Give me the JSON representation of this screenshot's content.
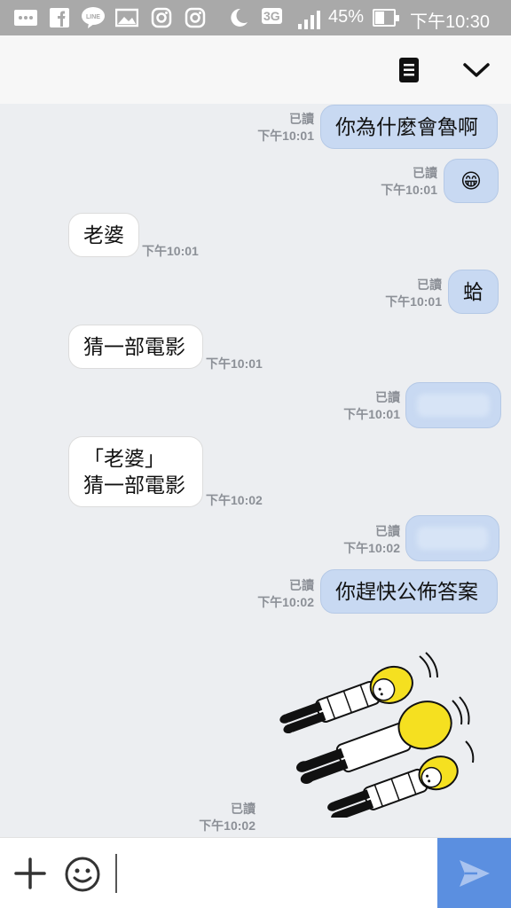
{
  "status_bar": {
    "icons": [
      "chat-dots-icon",
      "facebook-icon",
      "line-icon",
      "gallery-icon",
      "instagram-icon",
      "instagram-icon",
      "moon-icon",
      "signal-icon",
      "battery-icon"
    ],
    "network": "3G",
    "battery": "45%",
    "time": "下午10:30"
  },
  "header": {
    "menu_icon": "notes-icon",
    "collapse_icon": "chevron-down-icon"
  },
  "messages": [
    {
      "side": "me",
      "text": "你為什麼會魯啊",
      "read": "已讀",
      "time": "下午10:01"
    },
    {
      "side": "me",
      "text": "😁",
      "read": "已讀",
      "time": "下午10:01"
    },
    {
      "side": "them",
      "text": "老婆",
      "time": "下午10:01"
    },
    {
      "side": "me",
      "text": "蛤",
      "read": "已讀",
      "time": "下午10:01"
    },
    {
      "side": "them",
      "text": "猜一部電影",
      "time": "下午10:01"
    },
    {
      "side": "me",
      "text": "",
      "read": "已讀",
      "time": "下午10:01",
      "blurred": true
    },
    {
      "side": "them",
      "text": "「老婆」\n猜一部電影",
      "time": "下午10:02"
    },
    {
      "side": "me",
      "text": "",
      "read": "已讀",
      "time": "下午10:02",
      "blurred": true
    },
    {
      "side": "me",
      "text": "你趕快公佈答案",
      "read": "已讀",
      "time": "下午10:02"
    },
    {
      "side": "me",
      "sticker": "three-people-lying-sticker",
      "read": "已讀",
      "time": "下午10:02"
    }
  ],
  "input": {
    "placeholder": "",
    "value": "",
    "plus_icon": "plus-icon",
    "emoji_icon": "smiley-icon",
    "send_icon": "send-icon"
  },
  "colors": {
    "status_bar_bg": "#a9a9a9",
    "chat_bg": "#eceef1",
    "my_bubble": "#c8d9f2",
    "their_bubble": "#ffffff",
    "send_button": "#5b8fe0"
  }
}
